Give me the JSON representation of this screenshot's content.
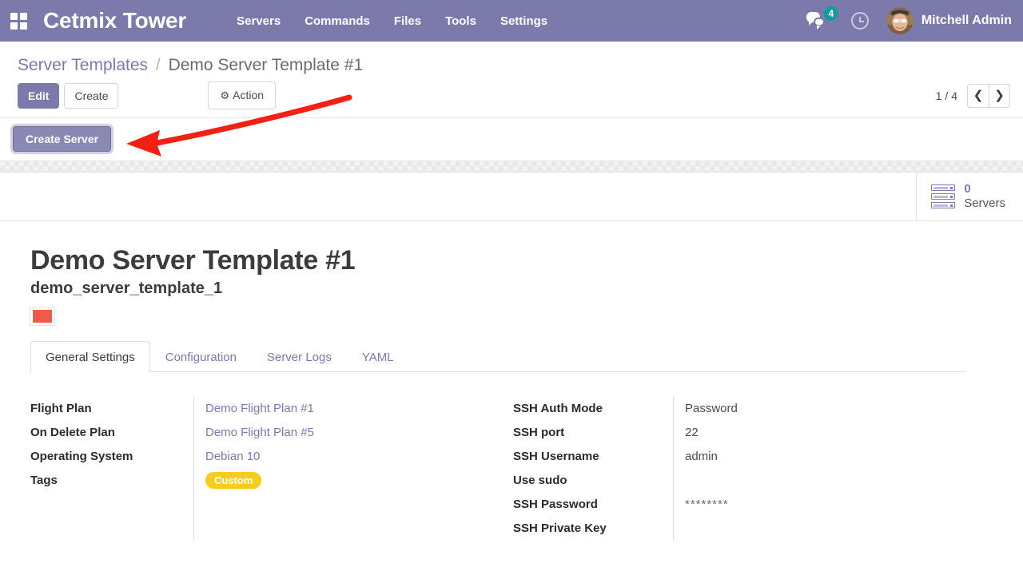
{
  "navbar": {
    "apps_icon": "apps-grid-icon",
    "brand": "Cetmix Tower",
    "links": [
      {
        "label": "Servers"
      },
      {
        "label": "Commands"
      },
      {
        "label": "Files"
      },
      {
        "label": "Tools"
      },
      {
        "label": "Settings"
      }
    ],
    "messages_icon": "chat-bubble-icon",
    "messages_count": "4",
    "activity_icon": "clock-icon",
    "avatar_icon": "user-avatar",
    "user_name": "Mitchell Admin",
    "background_color": "#7b7aab"
  },
  "breadcrumb": {
    "parent": "Server Templates",
    "separator": "/",
    "current": "Demo Server Template #1"
  },
  "toolbar": {
    "edit_label": "Edit",
    "create_label": "Create",
    "action_label": "Action",
    "action_icon": "gear-icon",
    "pager_text": "1 / 4",
    "prev_icon": "chevron-left-icon",
    "next_icon": "chevron-right-icon"
  },
  "action_bar": {
    "create_server_label": "Create Server"
  },
  "stat_button": {
    "icon": "server-rack-icon",
    "value": "0",
    "label": "Servers"
  },
  "record": {
    "title": "Demo Server Template #1",
    "technical_name": "demo_server_template_1",
    "color_swatch": "#ef5a4a"
  },
  "tabs": [
    {
      "label": "General Settings",
      "active": true
    },
    {
      "label": "Configuration",
      "active": false
    },
    {
      "label": "Server Logs",
      "active": false
    },
    {
      "label": "YAML",
      "active": false
    }
  ],
  "left_fields": [
    {
      "label": "Flight Plan",
      "value": "Demo Flight Plan #1",
      "kind": "link"
    },
    {
      "label": "On Delete Plan",
      "value": "Demo Flight Plan #5",
      "kind": "link"
    },
    {
      "label": "Operating System",
      "value": "Debian 10",
      "kind": "link"
    },
    {
      "label": "Tags",
      "value": "Custom",
      "kind": "tag"
    }
  ],
  "right_fields": [
    {
      "label": "SSH Auth Mode",
      "value": "Password",
      "kind": "text"
    },
    {
      "label": "SSH port",
      "value": "22",
      "kind": "text"
    },
    {
      "label": "SSH Username",
      "value": "admin",
      "kind": "text"
    },
    {
      "label": "Use sudo",
      "value": "",
      "kind": "text"
    },
    {
      "label": "SSH Password",
      "value": "********",
      "kind": "password"
    },
    {
      "label": "SSH Private Key",
      "value": "",
      "kind": "text"
    }
  ],
  "annotation": {
    "arrow_color": "#f32113",
    "arrow_target": "Create Server"
  }
}
